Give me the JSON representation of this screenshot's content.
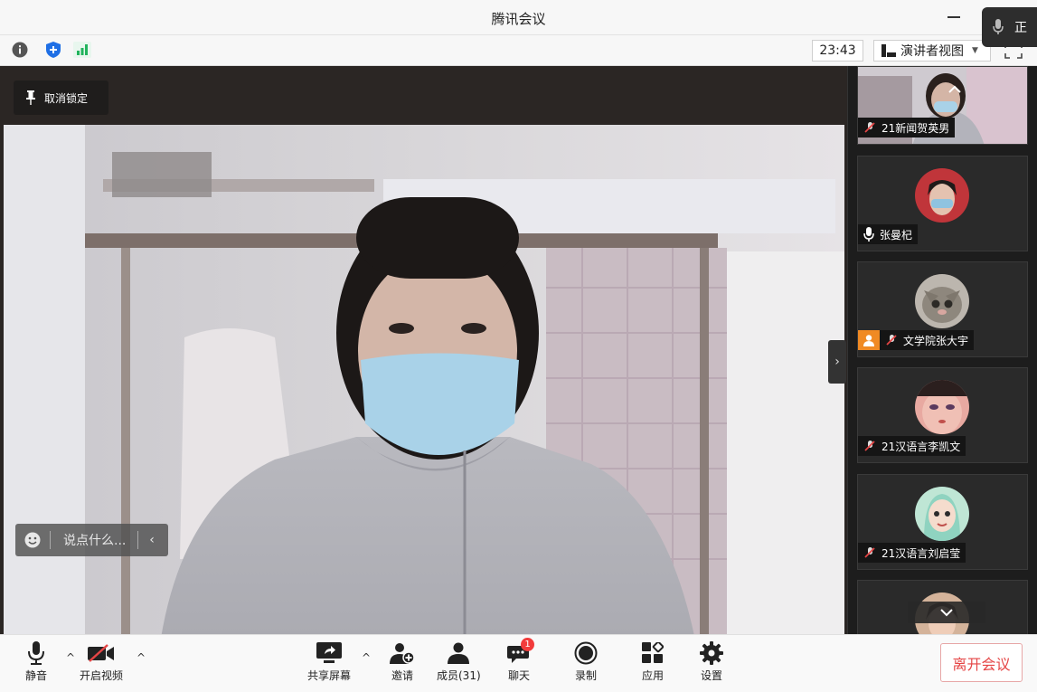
{
  "window": {
    "title": "腾讯会议"
  },
  "speaking_indicator": {
    "text": "正"
  },
  "infobar": {
    "timer": "23:43",
    "view_label": "演讲者视图"
  },
  "stage": {
    "unlock_label": "取消锁定",
    "chat_placeholder": "说点什么..."
  },
  "participants": [
    {
      "name": "21新闻贺英男",
      "mic": "muted",
      "type": "video"
    },
    {
      "name": "张曼杞",
      "mic": "on",
      "type": "avatar"
    },
    {
      "name": "文学院张大宇",
      "mic": "muted",
      "type": "avatar",
      "host": true
    },
    {
      "name": "21汉语言李凯文",
      "mic": "muted",
      "type": "avatar"
    },
    {
      "name": "21汉语言刘启莹",
      "mic": "muted",
      "type": "avatar"
    }
  ],
  "toolbar": {
    "mute_label": "静音",
    "video_label": "开启视频",
    "share_label": "共享屏幕",
    "invite_label": "邀请",
    "members_label": "成员(31)",
    "chat_label": "聊天",
    "chat_badge": "1",
    "record_label": "录制",
    "apps_label": "应用",
    "settings_label": "设置",
    "leave_label": "离开会议"
  },
  "colors": {
    "leave": "#e54545",
    "host": "#f08a24",
    "badge": "#f23b3b",
    "network": "#21b35c",
    "shield": "#1f6fe5"
  }
}
